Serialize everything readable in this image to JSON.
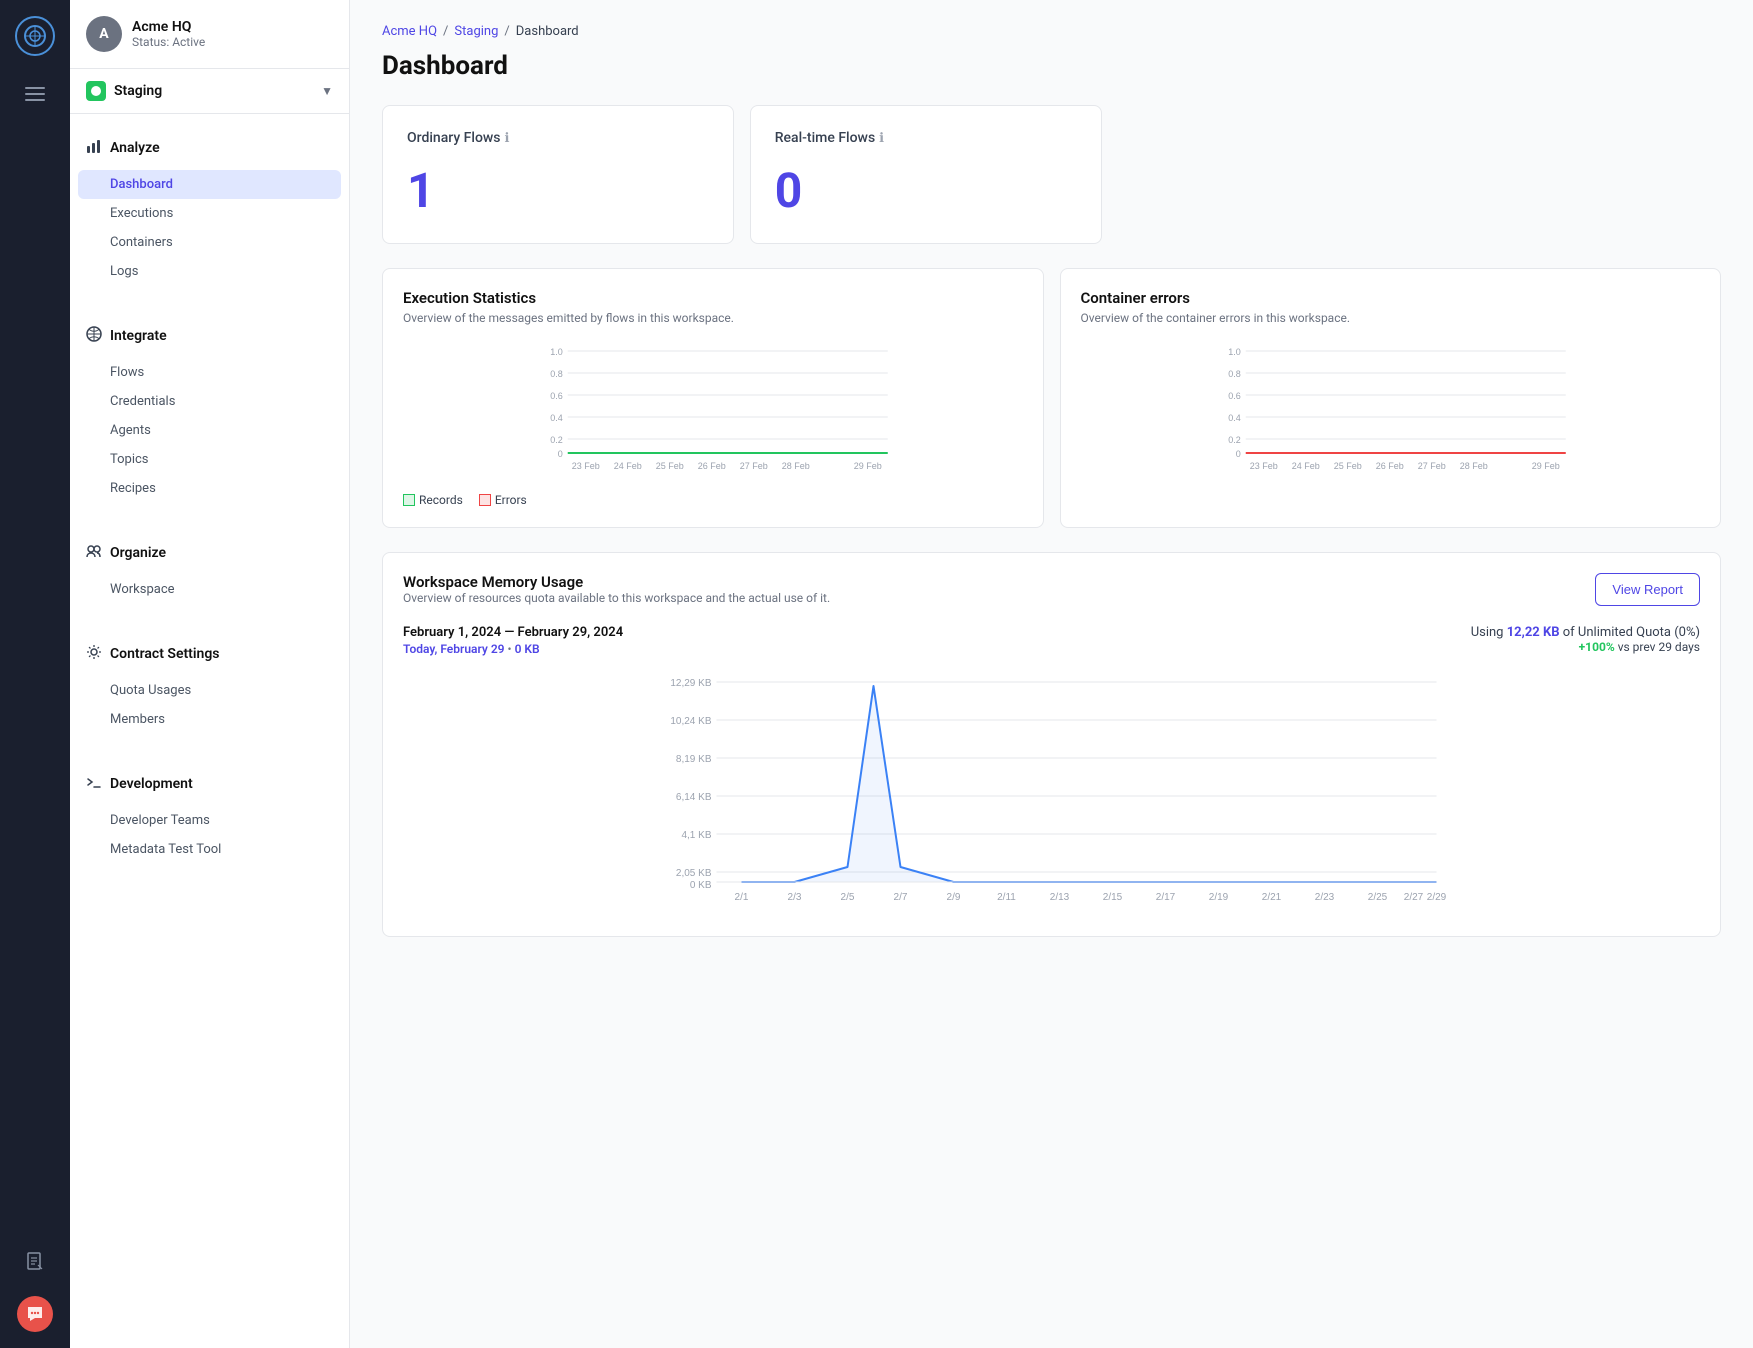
{
  "iconBar": {
    "logo": "⬡",
    "navIcons": [
      "≡"
    ],
    "docIcon": "🗋",
    "chatIcon": "💬"
  },
  "sidebar": {
    "org": {
      "initial": "A",
      "name": "Acme HQ",
      "status": "Status: Active"
    },
    "environment": {
      "name": "Staging",
      "chevron": "▼"
    },
    "sections": {
      "analyze": {
        "label": "Analyze",
        "icon": "📊",
        "items": [
          {
            "label": "Dashboard",
            "active": true,
            "key": "dashboard"
          },
          {
            "label": "Executions",
            "active": false,
            "key": "executions"
          },
          {
            "label": "Containers",
            "active": false,
            "key": "containers"
          },
          {
            "label": "Logs",
            "active": false,
            "key": "logs"
          }
        ]
      },
      "integrate": {
        "label": "Integrate",
        "icon": "⬤",
        "items": [
          {
            "label": "Flows",
            "active": false,
            "key": "flows"
          },
          {
            "label": "Credentials",
            "active": false,
            "key": "credentials"
          },
          {
            "label": "Agents",
            "active": false,
            "key": "agents"
          },
          {
            "label": "Topics",
            "active": false,
            "key": "topics"
          },
          {
            "label": "Recipes",
            "active": false,
            "key": "recipes"
          }
        ]
      },
      "organize": {
        "label": "Organize",
        "icon": "👥",
        "items": [
          {
            "label": "Workspace",
            "active": false,
            "key": "workspace"
          }
        ]
      },
      "contractSettings": {
        "label": "Contract Settings",
        "icon": "⚙",
        "items": [
          {
            "label": "Quota Usages",
            "active": false,
            "key": "quota-usages"
          },
          {
            "label": "Members",
            "active": false,
            "key": "members"
          }
        ]
      },
      "development": {
        "label": "Development",
        "icon": "🔧",
        "items": [
          {
            "label": "Developer Teams",
            "active": false,
            "key": "developer-teams"
          },
          {
            "label": "Metadata Test Tool",
            "active": false,
            "key": "metadata-test-tool"
          }
        ]
      }
    }
  },
  "breadcrumb": {
    "items": [
      "Acme HQ",
      "Staging",
      "Dashboard"
    ],
    "separator": "/"
  },
  "page": {
    "title": "Dashboard"
  },
  "stats": {
    "ordinaryFlows": {
      "label": "Ordinary Flows",
      "value": "1",
      "infoIcon": "ℹ"
    },
    "realTimeFlows": {
      "label": "Real-time Flows",
      "value": "0",
      "infoIcon": "ℹ"
    }
  },
  "executionStats": {
    "title": "Execution Statistics",
    "subtitle": "Overview of the messages emitted by flows in this workspace.",
    "legend": {
      "records": "Records",
      "errors": "Errors"
    },
    "dates": [
      "23 Feb",
      "24 Feb",
      "25 Feb",
      "26 Feb",
      "27 Feb",
      "28 Feb",
      "29 Feb"
    ],
    "yLabels": [
      "0",
      "0.2",
      "0.4",
      "0.6",
      "0.8",
      "1.0"
    ]
  },
  "containerErrors": {
    "title": "Container errors",
    "subtitle": "Overview of the container errors in this workspace.",
    "dates": [
      "23 Feb",
      "24 Feb",
      "25 Feb",
      "26 Feb",
      "27 Feb",
      "28 Feb",
      "29 Feb"
    ],
    "yLabels": [
      "0",
      "0.2",
      "0.4",
      "0.6",
      "0.8",
      "1.0"
    ]
  },
  "memoryUsage": {
    "title": "Workspace Memory Usage",
    "subtitle": "Overview of resources quota available to this workspace and the actual use of it.",
    "dateRange": "February 1, 2024 — February 29, 2024",
    "today": "Today, February 29",
    "todayValue": "0 KB",
    "using": "Using",
    "usingValue": "12,22 KB",
    "quota": "of Unlimited Quota (0%)",
    "percentChange": "+100%",
    "percentLabel": "vs prev 29 days",
    "viewReportBtn": "View Report",
    "xLabels": [
      "2/1",
      "2/3",
      "2/5",
      "2/7",
      "2/9",
      "2/11",
      "2/13",
      "2/15",
      "2/17",
      "2/19",
      "2/21",
      "2/23",
      "2/25",
      "2/27",
      "2/29"
    ],
    "yLabels": [
      "0 KB",
      "2,05 KB",
      "4,1 KB",
      "6,14 KB",
      "8,19 KB",
      "10,24 KB",
      "12,29 KB"
    ]
  }
}
